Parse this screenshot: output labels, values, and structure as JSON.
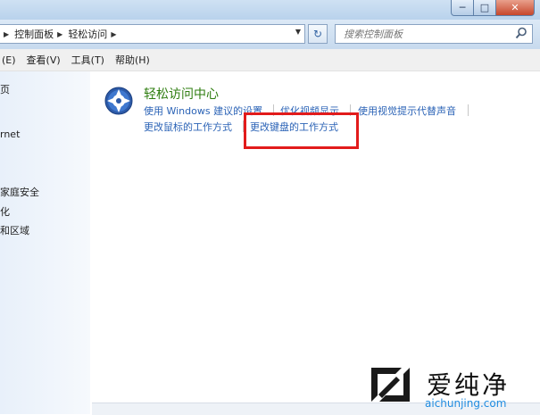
{
  "window": {
    "controls": {
      "minimize": "─",
      "maximize": "□",
      "close": "✕"
    }
  },
  "address": {
    "breadcrumbs": [
      "控制面板",
      "轻松访问"
    ],
    "search_placeholder": "搜索控制面板"
  },
  "menu": {
    "items": [
      "(E)",
      "查看(V)",
      "工具(T)",
      "帮助(H)"
    ]
  },
  "sidebar": {
    "items": [
      "页",
      "rnet",
      "家庭安全",
      "化",
      "和区域"
    ]
  },
  "category": {
    "title": "轻松访问中心",
    "links": [
      "使用 Windows 建议的设置",
      "优化视频显示",
      "使用视觉提示代替声音",
      "更改鼠标的工作方式",
      "更改键盘的工作方式"
    ]
  },
  "colors": {
    "link": "#2b63b6",
    "category_title": "#2e7d0f",
    "highlight_border": "#e21b1b"
  },
  "watermark": {
    "brand": "爱纯净",
    "url": "aichunjing.com"
  }
}
